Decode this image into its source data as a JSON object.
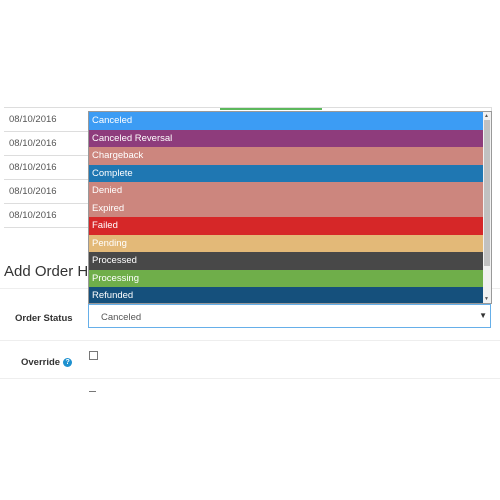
{
  "history": {
    "rows": [
      {
        "date": "08/10/2016"
      },
      {
        "date": "08/10/2016"
      },
      {
        "date": "08/10/2016"
      },
      {
        "date": "08/10/2016"
      },
      {
        "date": "08/10/2016"
      }
    ],
    "accent_color": "#5cb85c"
  },
  "add_history": {
    "heading": "Add Order Hist"
  },
  "order_status": {
    "label": "Order Status",
    "selected": "Canceled",
    "options": [
      {
        "label": "Canceled",
        "color": "#3c9cf4"
      },
      {
        "label": "Canceled Reversal",
        "color": "#8e3c7c"
      },
      {
        "label": "Chargeback",
        "color": "#cc867e"
      },
      {
        "label": "Complete",
        "color": "#1f77b2"
      },
      {
        "label": "Denied",
        "color": "#cc867e"
      },
      {
        "label": "Expired",
        "color": "#cc867e"
      },
      {
        "label": "Failed",
        "color": "#d62728"
      },
      {
        "label": "Pending",
        "color": "#e3b978"
      },
      {
        "label": "Processed",
        "color": "#484848"
      },
      {
        "label": "Processing",
        "color": "#6fae4a"
      },
      {
        "label": "Refunded",
        "color": "#15507c"
      }
    ]
  },
  "override": {
    "label": "Override",
    "icon": "help-icon",
    "help_glyph": "?"
  }
}
